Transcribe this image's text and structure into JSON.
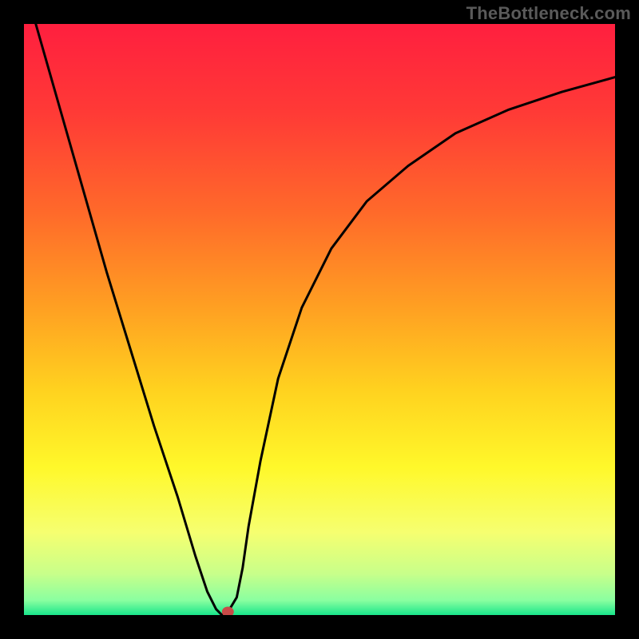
{
  "attribution": "TheBottleneck.com",
  "chart_data": {
    "type": "line",
    "title": "",
    "xlabel": "",
    "ylabel": "",
    "xlim": [
      0,
      100
    ],
    "ylim": [
      0,
      100
    ],
    "background_gradient": {
      "stops": [
        {
          "offset": 0.0,
          "color": "#ff1f3f"
        },
        {
          "offset": 0.15,
          "color": "#ff3a36"
        },
        {
          "offset": 0.32,
          "color": "#ff6a2a"
        },
        {
          "offset": 0.48,
          "color": "#ffa022"
        },
        {
          "offset": 0.62,
          "color": "#ffd21f"
        },
        {
          "offset": 0.75,
          "color": "#fff82a"
        },
        {
          "offset": 0.86,
          "color": "#f6ff70"
        },
        {
          "offset": 0.93,
          "color": "#c8ff8a"
        },
        {
          "offset": 0.975,
          "color": "#5uffa0"
        },
        {
          "offset": 1.0,
          "color": "#19e68b"
        }
      ]
    },
    "series": [
      {
        "name": "bottleneck_curve",
        "x": [
          2,
          6,
          10,
          14,
          18,
          22,
          26,
          29,
          31,
          32.5,
          33.5,
          34.5,
          36,
          37,
          38,
          40,
          43,
          47,
          52,
          58,
          65,
          73,
          82,
          91,
          100
        ],
        "y": [
          100,
          86,
          72,
          58,
          45,
          32,
          20,
          10,
          4,
          1,
          0,
          0.5,
          3,
          8,
          15,
          26,
          40,
          52,
          62,
          70,
          76,
          81.5,
          85.5,
          88.5,
          91
        ]
      }
    ],
    "marker": {
      "x": 34.5,
      "y": 0,
      "color": "#c94a48"
    },
    "colors": {
      "curve": "#000000",
      "frame": "#000000"
    }
  }
}
